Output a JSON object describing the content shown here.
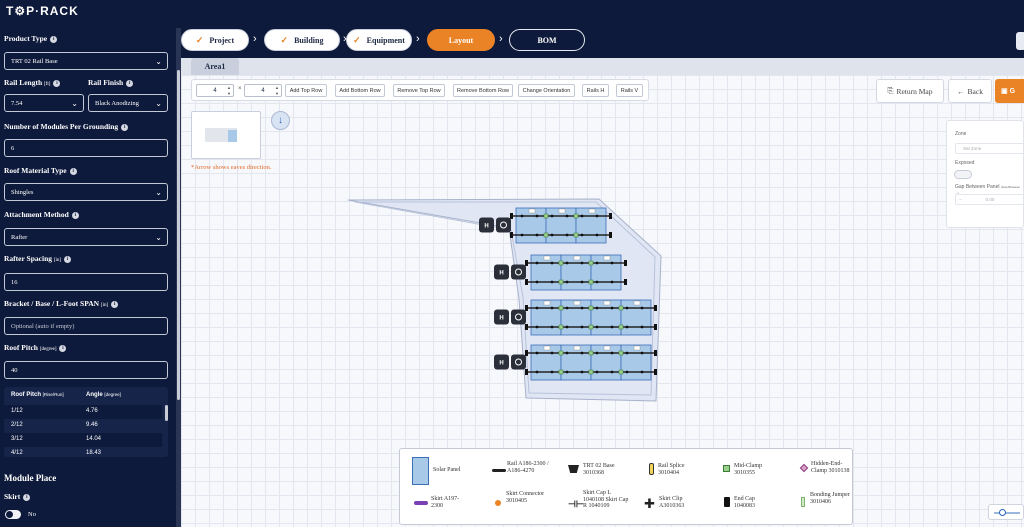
{
  "app": {
    "logo_text": "T⚙P·RACK"
  },
  "steps": [
    {
      "label": "Project",
      "done": true
    },
    {
      "label": "Building",
      "done": true
    },
    {
      "label": "Equipment",
      "done": true
    },
    {
      "label": "Layout",
      "done": false,
      "active": true
    },
    {
      "label": "BOM",
      "done": false
    }
  ],
  "sidebar": {
    "product_type_label": "Product Type",
    "product_type_value": "TRT 02 Rail Base",
    "rail_length_label": "Rail Length",
    "rail_length_unit": "[ft]",
    "rail_length_value": "7.54",
    "rail_finish_label": "Rail Finish",
    "rail_finish_value": "Black Anodizing",
    "modules_per_grounding_label": "Number of Modules Per Grounding",
    "modules_per_grounding_value": "6",
    "roof_material_label": "Roof Material Type",
    "roof_material_value": "Shingles",
    "attachment_method_label": "Attachment Method",
    "attachment_method_value": "Rafter",
    "rafter_spacing_label": "Rafter Spacing",
    "rafter_spacing_unit": "[in]",
    "rafter_spacing_value": "16",
    "bracket_span_label": "Bracket / Base / L-Foot SPAN",
    "bracket_span_unit": "[in]",
    "bracket_span_placeholder": "Optional (auto if empty)",
    "roof_pitch_label": "Roof Pitch",
    "roof_pitch_unit": "[degree]",
    "roof_pitch_value": "40",
    "pitch_table": {
      "col1": "Roof Pitch",
      "col1_unit": "[Rise/Run]",
      "col2": "Angle",
      "col2_unit": "[degree]",
      "rows": [
        {
          "pitch": "1/12",
          "angle": "4.76"
        },
        {
          "pitch": "2/12",
          "angle": "9.46"
        },
        {
          "pitch": "3/12",
          "angle": "14.04"
        },
        {
          "pitch": "4/12",
          "angle": "18.43"
        }
      ]
    },
    "module_place_label": "Module Place",
    "skirt_label": "Skirt",
    "skirt_value": "No"
  },
  "area_tab": "Area1",
  "toolbar": {
    "cols_value": "4",
    "times": "×",
    "rows_value": "4",
    "buttons": [
      "Add Top Row",
      "Add Bottom Row",
      "Remove Top Row",
      "Remove Bottom Row",
      "Change Orientation",
      "Rails H",
      "Rails V"
    ]
  },
  "eaves_note": "*Arrow shows eaves direction.",
  "actions": {
    "return_map": "Return Map",
    "back": "Back",
    "next": "G"
  },
  "zone_panel": {
    "zone_label": "Zone",
    "zone_placeholder": "Set Zone",
    "exposed_label": "Exposed",
    "gap_label": "Gap Between Panel",
    "gap_unit": "(Gap Between ...)",
    "gap_value": "0.00"
  },
  "row_controls": {
    "h_label": "H",
    "rotate_icon": "rotate-icon"
  },
  "legend": [
    {
      "label": "Solar Panel",
      "icon": "solar-panel-icon"
    },
    {
      "label": "Rail A186-2300 / A186-4270",
      "icon": "rail-icon"
    },
    {
      "label": "TRT 02 Base 3010368",
      "icon": "base-icon"
    },
    {
      "label": "Rail Splice 3010404",
      "icon": "rail-splice-icon"
    },
    {
      "label": "Mid-Clamp 3010355",
      "icon": "mid-clamp-icon"
    },
    {
      "label": "Hidden-End-Clamp 3010138",
      "icon": "hidden-end-clamp-icon"
    },
    {
      "label": "Skirt A197-2300",
      "icon": "skirt-icon"
    },
    {
      "label": "Skirt Connector 3010405",
      "icon": "skirt-connector-icon"
    },
    {
      "label": "Skirt Cap L 1040108 Skirt Cap R 1040109",
      "icon": "skirt-cap-icon"
    },
    {
      "label": "Skirt Clip A3010363",
      "icon": "skirt-clip-icon"
    },
    {
      "label": "End Cap 1040083",
      "icon": "end-cap-icon"
    },
    {
      "label": "Bonding Jumper 3010406",
      "icon": "bonding-jumper-icon"
    }
  ],
  "colors": {
    "navy": "#0e1a3b",
    "accent": "#e98326",
    "panel": "#a9c9e8"
  }
}
